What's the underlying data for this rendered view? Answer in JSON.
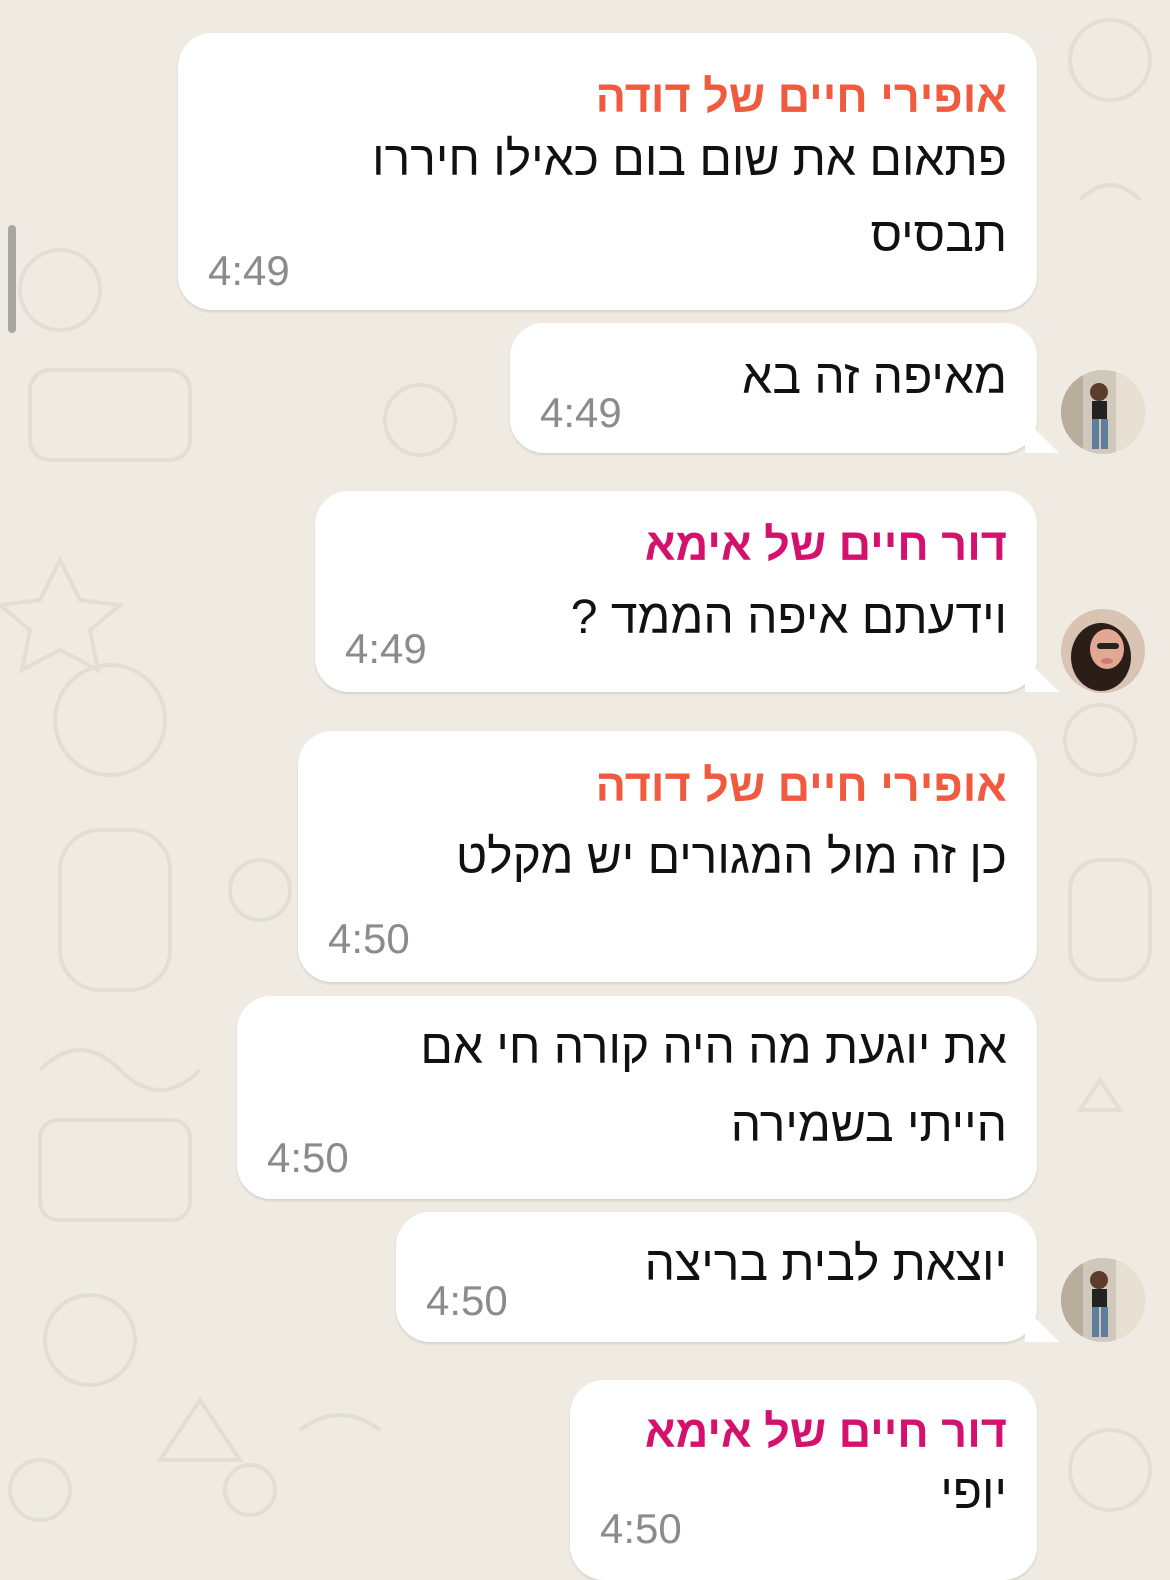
{
  "chat": {
    "messages": [
      {
        "sender": "אופירי חיים של דודה",
        "lines": [
          "פתאום את שום בום כאילו חיררו",
          "תבסיס"
        ],
        "time": "4:49"
      },
      {
        "lines": [
          "מאיפה זה בא"
        ],
        "time": "4:49"
      },
      {
        "sender": "דור חיים של אימא",
        "lines": [
          "וידעתם איפה הממד ?"
        ],
        "time": "4:49"
      },
      {
        "sender": "אופירי חיים של דודה",
        "lines": [
          "כן זה מול המגורים יש מקלט"
        ],
        "time": "4:50"
      },
      {
        "lines": [
          "את יוגעת מה היה קורה חי אם",
          "הייתי בשמירה"
        ],
        "time": "4:50"
      },
      {
        "lines": [
          "יוצאת לבית בריצה"
        ],
        "time": "4:50"
      },
      {
        "sender": "דור חיים של אימא",
        "lines": [
          "יופי"
        ],
        "time": "4:50"
      }
    ]
  },
  "colors": {
    "background": "#efeae2",
    "bubble": "#ffffff",
    "sender_orange": "#f05a3f",
    "sender_pink": "#d4126e",
    "timestamp": "#8b8b8b"
  }
}
